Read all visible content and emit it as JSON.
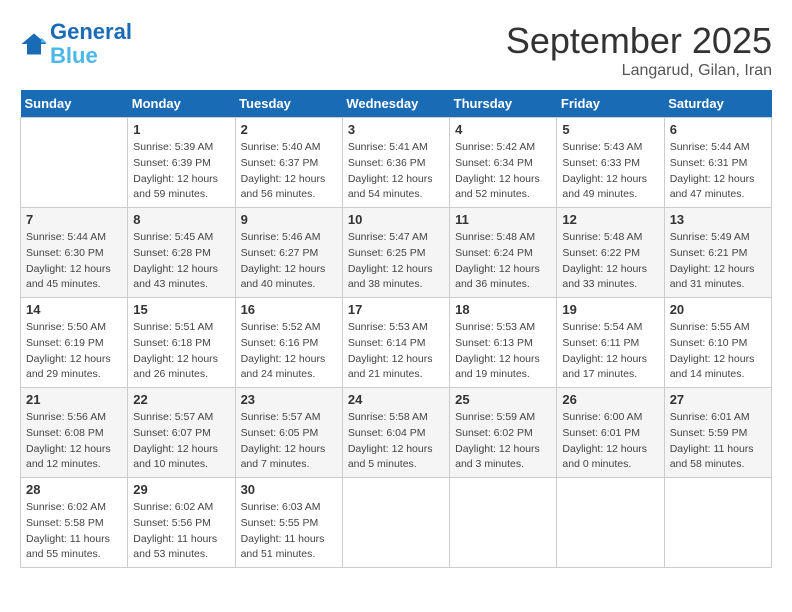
{
  "header": {
    "logo_line1": "General",
    "logo_line2": "Blue",
    "month": "September 2025",
    "location": "Langarud, Gilan, Iran"
  },
  "days_of_week": [
    "Sunday",
    "Monday",
    "Tuesday",
    "Wednesday",
    "Thursday",
    "Friday",
    "Saturday"
  ],
  "weeks": [
    [
      {
        "day": "",
        "info": ""
      },
      {
        "day": "1",
        "info": "Sunrise: 5:39 AM\nSunset: 6:39 PM\nDaylight: 12 hours\nand 59 minutes."
      },
      {
        "day": "2",
        "info": "Sunrise: 5:40 AM\nSunset: 6:37 PM\nDaylight: 12 hours\nand 56 minutes."
      },
      {
        "day": "3",
        "info": "Sunrise: 5:41 AM\nSunset: 6:36 PM\nDaylight: 12 hours\nand 54 minutes."
      },
      {
        "day": "4",
        "info": "Sunrise: 5:42 AM\nSunset: 6:34 PM\nDaylight: 12 hours\nand 52 minutes."
      },
      {
        "day": "5",
        "info": "Sunrise: 5:43 AM\nSunset: 6:33 PM\nDaylight: 12 hours\nand 49 minutes."
      },
      {
        "day": "6",
        "info": "Sunrise: 5:44 AM\nSunset: 6:31 PM\nDaylight: 12 hours\nand 47 minutes."
      }
    ],
    [
      {
        "day": "7",
        "info": "Sunrise: 5:44 AM\nSunset: 6:30 PM\nDaylight: 12 hours\nand 45 minutes."
      },
      {
        "day": "8",
        "info": "Sunrise: 5:45 AM\nSunset: 6:28 PM\nDaylight: 12 hours\nand 43 minutes."
      },
      {
        "day": "9",
        "info": "Sunrise: 5:46 AM\nSunset: 6:27 PM\nDaylight: 12 hours\nand 40 minutes."
      },
      {
        "day": "10",
        "info": "Sunrise: 5:47 AM\nSunset: 6:25 PM\nDaylight: 12 hours\nand 38 minutes."
      },
      {
        "day": "11",
        "info": "Sunrise: 5:48 AM\nSunset: 6:24 PM\nDaylight: 12 hours\nand 36 minutes."
      },
      {
        "day": "12",
        "info": "Sunrise: 5:48 AM\nSunset: 6:22 PM\nDaylight: 12 hours\nand 33 minutes."
      },
      {
        "day": "13",
        "info": "Sunrise: 5:49 AM\nSunset: 6:21 PM\nDaylight: 12 hours\nand 31 minutes."
      }
    ],
    [
      {
        "day": "14",
        "info": "Sunrise: 5:50 AM\nSunset: 6:19 PM\nDaylight: 12 hours\nand 29 minutes."
      },
      {
        "day": "15",
        "info": "Sunrise: 5:51 AM\nSunset: 6:18 PM\nDaylight: 12 hours\nand 26 minutes."
      },
      {
        "day": "16",
        "info": "Sunrise: 5:52 AM\nSunset: 6:16 PM\nDaylight: 12 hours\nand 24 minutes."
      },
      {
        "day": "17",
        "info": "Sunrise: 5:53 AM\nSunset: 6:14 PM\nDaylight: 12 hours\nand 21 minutes."
      },
      {
        "day": "18",
        "info": "Sunrise: 5:53 AM\nSunset: 6:13 PM\nDaylight: 12 hours\nand 19 minutes."
      },
      {
        "day": "19",
        "info": "Sunrise: 5:54 AM\nSunset: 6:11 PM\nDaylight: 12 hours\nand 17 minutes."
      },
      {
        "day": "20",
        "info": "Sunrise: 5:55 AM\nSunset: 6:10 PM\nDaylight: 12 hours\nand 14 minutes."
      }
    ],
    [
      {
        "day": "21",
        "info": "Sunrise: 5:56 AM\nSunset: 6:08 PM\nDaylight: 12 hours\nand 12 minutes."
      },
      {
        "day": "22",
        "info": "Sunrise: 5:57 AM\nSunset: 6:07 PM\nDaylight: 12 hours\nand 10 minutes."
      },
      {
        "day": "23",
        "info": "Sunrise: 5:57 AM\nSunset: 6:05 PM\nDaylight: 12 hours\nand 7 minutes."
      },
      {
        "day": "24",
        "info": "Sunrise: 5:58 AM\nSunset: 6:04 PM\nDaylight: 12 hours\nand 5 minutes."
      },
      {
        "day": "25",
        "info": "Sunrise: 5:59 AM\nSunset: 6:02 PM\nDaylight: 12 hours\nand 3 minutes."
      },
      {
        "day": "26",
        "info": "Sunrise: 6:00 AM\nSunset: 6:01 PM\nDaylight: 12 hours\nand 0 minutes."
      },
      {
        "day": "27",
        "info": "Sunrise: 6:01 AM\nSunset: 5:59 PM\nDaylight: 11 hours\nand 58 minutes."
      }
    ],
    [
      {
        "day": "28",
        "info": "Sunrise: 6:02 AM\nSunset: 5:58 PM\nDaylight: 11 hours\nand 55 minutes."
      },
      {
        "day": "29",
        "info": "Sunrise: 6:02 AM\nSunset: 5:56 PM\nDaylight: 11 hours\nand 53 minutes."
      },
      {
        "day": "30",
        "info": "Sunrise: 6:03 AM\nSunset: 5:55 PM\nDaylight: 11 hours\nand 51 minutes."
      },
      {
        "day": "",
        "info": ""
      },
      {
        "day": "",
        "info": ""
      },
      {
        "day": "",
        "info": ""
      },
      {
        "day": "",
        "info": ""
      }
    ]
  ]
}
